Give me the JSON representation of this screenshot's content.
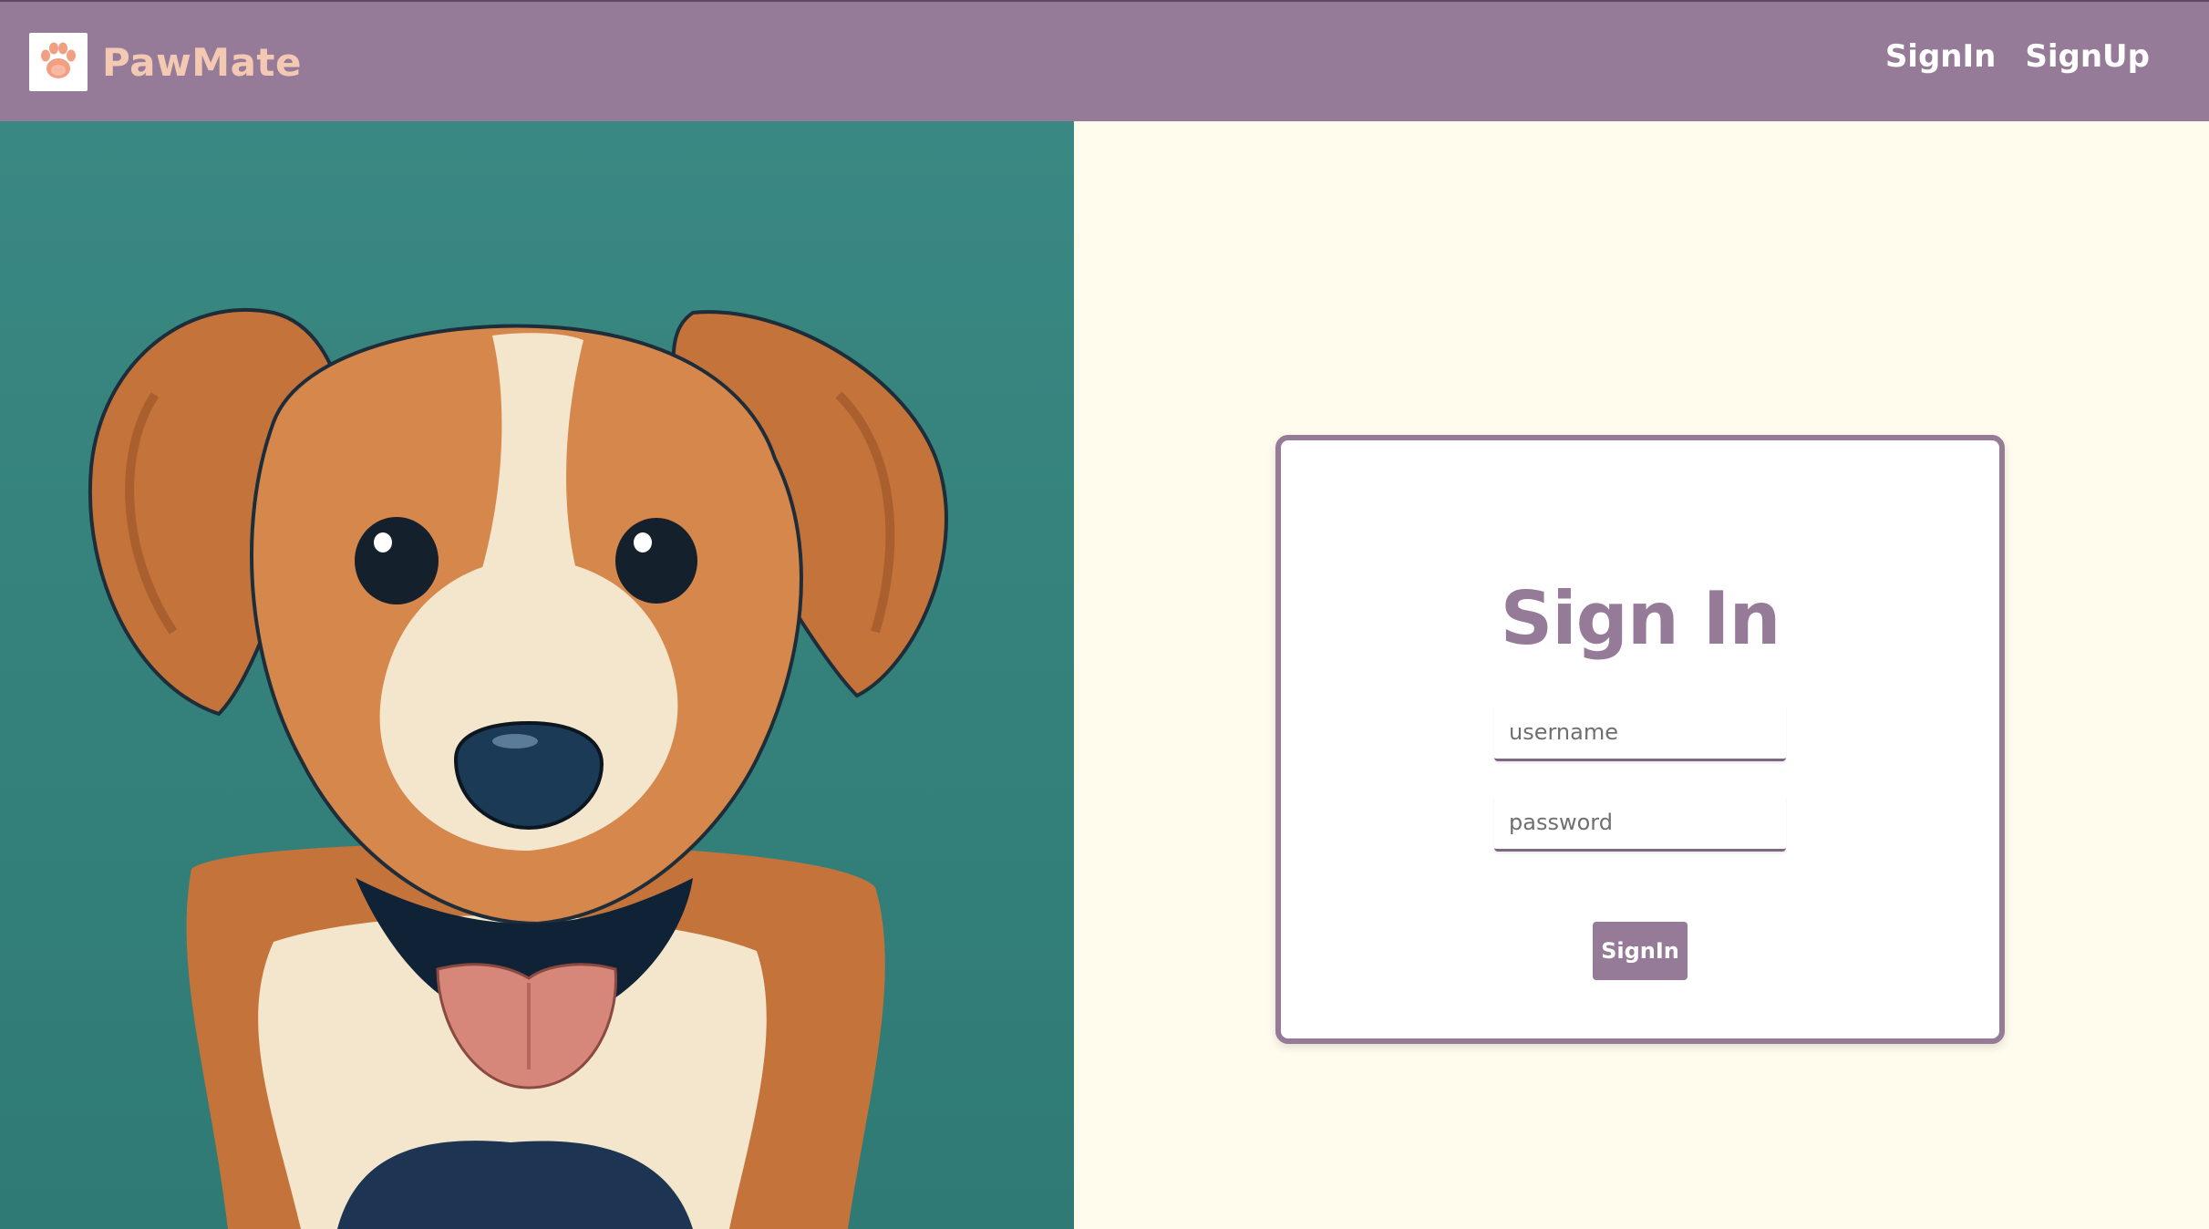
{
  "brand": {
    "name": "PawMate",
    "logo_icon": "paw-icon"
  },
  "nav": {
    "signin_label": "SignIn",
    "signup_label": "SignUp"
  },
  "hero": {
    "image": "dog-illustration"
  },
  "form": {
    "title": "Sign In",
    "username_placeholder": "username",
    "password_placeholder": "password",
    "submit_label": "SignIn"
  },
  "colors": {
    "navbar": "#967b98",
    "brand_text": "#f4c9b4",
    "hero_bg": "#3a8883",
    "page_bg": "#fffcee",
    "accent": "#967b98"
  }
}
